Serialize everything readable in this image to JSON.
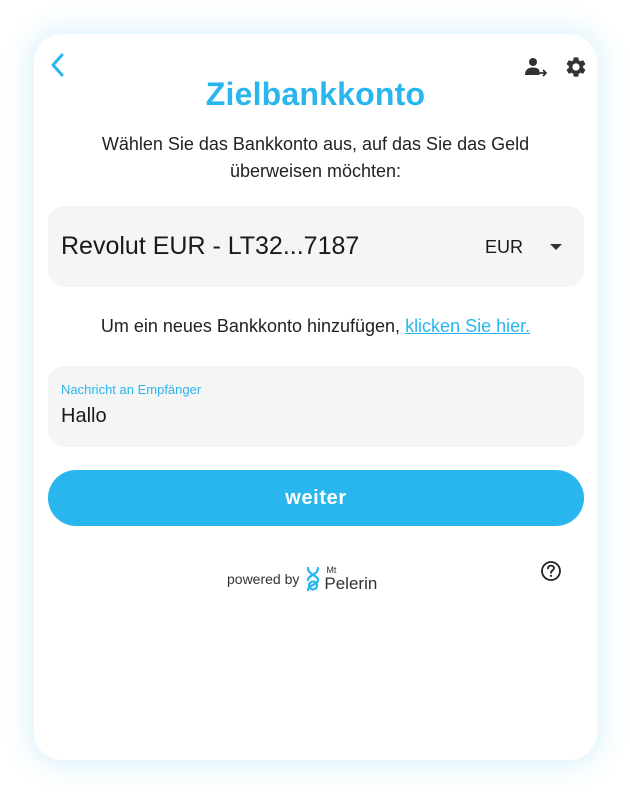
{
  "header": {
    "title": "Zielbankkonto",
    "icons": [
      "back-arrow-icon",
      "user-transfer-icon",
      "gear-icon"
    ]
  },
  "subtitle": "Wählen Sie das Bankkonto aus, auf das Sie das Geld überweisen möchten:",
  "account": {
    "selected": "Revolut EUR - LT32...7187",
    "currency": "EUR"
  },
  "add_account": {
    "text": "Um ein neues Bankkonto hinzufügen, ",
    "link": "klicken Sie hier."
  },
  "message": {
    "label": "Nachricht an Empfänger",
    "value": "Hallo"
  },
  "next_button": "weiter",
  "footer": {
    "powered_by": "powered by",
    "logo_small": "Mt",
    "logo_main": "Pelerin",
    "help_icon": "help-circle-icon"
  },
  "colors": {
    "accent": "#29b6ee",
    "field_bg": "#f5f5f5",
    "text": "#222222"
  }
}
